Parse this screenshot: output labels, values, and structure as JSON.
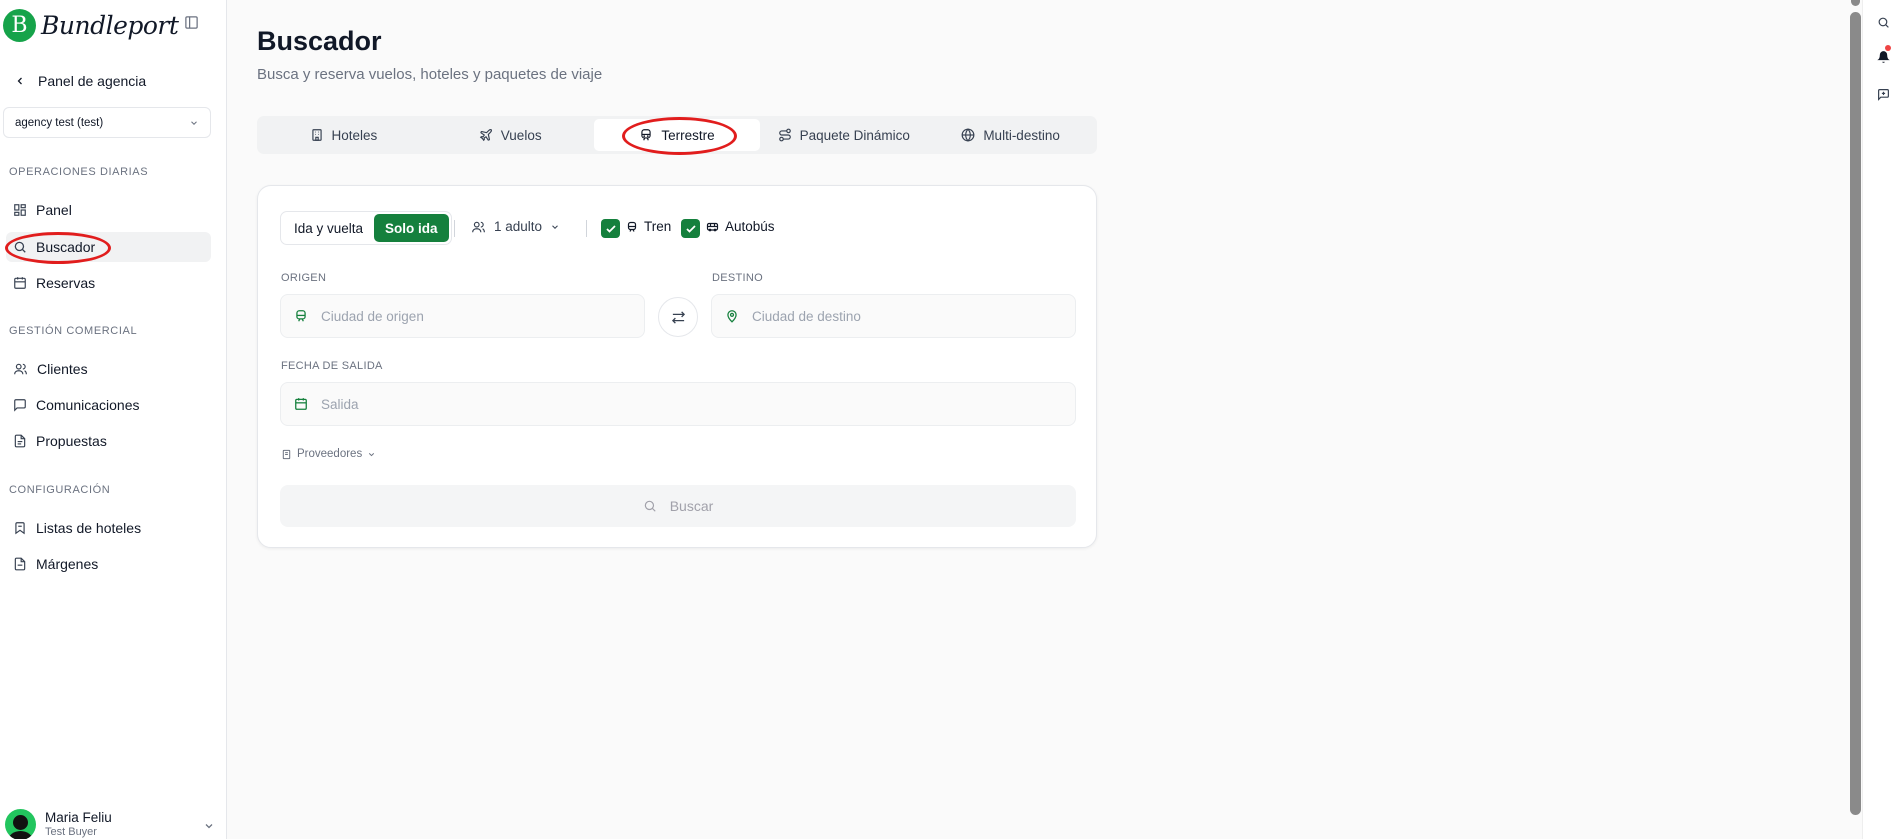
{
  "app": {
    "logo_letter": "B",
    "brand": "Bundleport"
  },
  "sidebar": {
    "back_label": "Panel de agencia",
    "agency": "agency test (test)",
    "sections": {
      "daily": "OPERACIONES DIARIAS",
      "commercial": "GESTIÓN COMERCIAL",
      "config": "CONFIGURACIÓN"
    },
    "items": {
      "panel": "Panel",
      "buscador": "Buscador",
      "reservas": "Reservas",
      "clientes": "Clientes",
      "comunicaciones": "Comunicaciones",
      "propuestas": "Propuestas",
      "listas_hoteles": "Listas de hoteles",
      "margenes": "Márgenes"
    },
    "active_item": "Buscador",
    "user": {
      "name": "Maria Feliu",
      "role": "Test Buyer"
    }
  },
  "main": {
    "title": "Buscador",
    "subtitle": "Busca y reserva vuelos, hoteles y paquetes de viaje",
    "tabs": {
      "hoteles": "Hoteles",
      "vuelos": "Vuelos",
      "terrestre": "Terrestre",
      "paquete": "Paquete Dinámico",
      "multi": "Multi-destino"
    },
    "active_tab": "Terrestre",
    "form": {
      "trip_roundtrip": "Ida y vuelta",
      "trip_oneway": "Solo ida",
      "trip_selected": "Solo ida",
      "passengers": "1 adulto",
      "train_label": "Tren",
      "train_checked": true,
      "bus_label": "Autobús",
      "bus_checked": true,
      "origin_label": "ORIGEN",
      "origin_placeholder": "Ciudad de origen",
      "destination_label": "DESTINO",
      "destination_placeholder": "Ciudad de destino",
      "departure_label": "FECHA DE SALIDA",
      "departure_placeholder": "Salida",
      "providers_label": "Proveedores",
      "search_label": "Buscar"
    }
  },
  "icons": {
    "collapse": "sidebar-toggle-icon",
    "back": "chevron-left-icon",
    "search": "search-icon",
    "notifications": "bell-icon",
    "feedback": "message-plus-icon"
  },
  "colors": {
    "accent": "#15803d",
    "annotation": "#e11d1d",
    "brand": "#16a34a"
  }
}
